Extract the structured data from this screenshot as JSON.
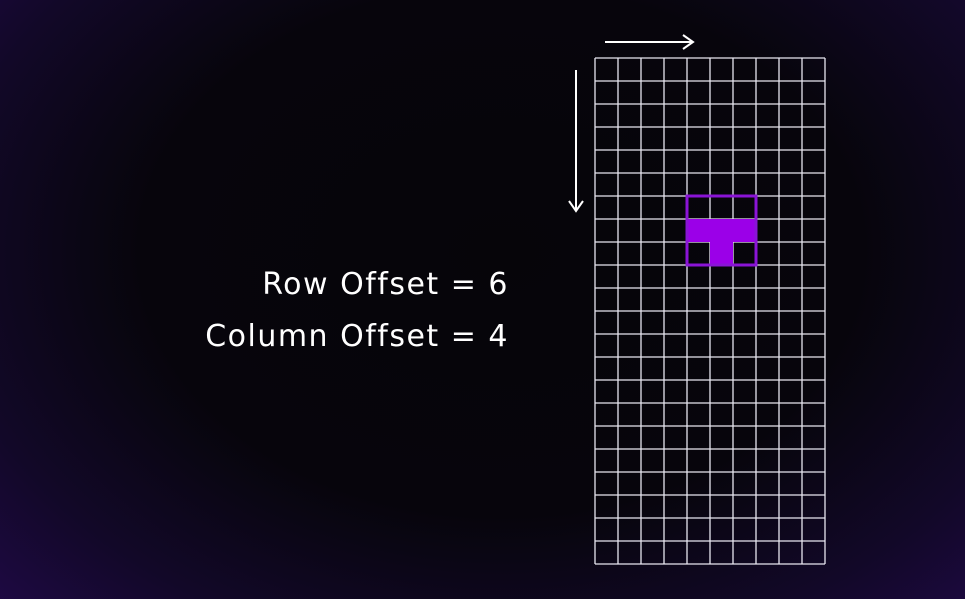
{
  "labels": {
    "row_offset": "Row Offset = 6",
    "column_offset": "Column Offset = 4"
  },
  "grid": {
    "rows": 22,
    "cols": 10,
    "line_color": "#e8e6f0"
  },
  "piece": {
    "origin_row": 6,
    "origin_col": 4,
    "box_size": 3,
    "filled_cells": [
      [
        1,
        0
      ],
      [
        1,
        1
      ],
      [
        1,
        2
      ],
      [
        2,
        1
      ]
    ],
    "fill_color": "#9b00e8",
    "border_color": "#8a14d6"
  },
  "arrows": {
    "color": "#ffffff",
    "column_direction": "right",
    "row_direction": "down"
  },
  "colors": {
    "background": "#060509",
    "vignette": "#230a4e",
    "text": "#ffffff"
  }
}
